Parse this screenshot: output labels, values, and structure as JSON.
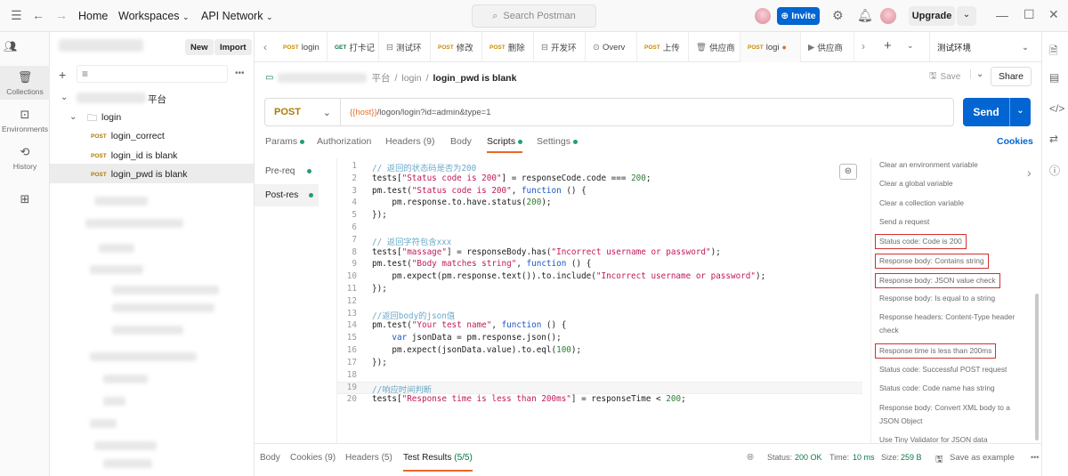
{
  "topbar": {
    "home": "Home",
    "workspaces": "Workspaces",
    "api_network": "API Network",
    "search_placeholder": "Search Postman",
    "invite": "Invite",
    "upgrade": "Upgrade"
  },
  "rail": {
    "collections": "Collections",
    "environments": "Environments",
    "history": "History"
  },
  "sidebar": {
    "new_label": "New",
    "import_label": "Import",
    "workspace_suffix": "平台",
    "folder": "login",
    "requests": [
      {
        "method": "POST",
        "name": "login_correct"
      },
      {
        "method": "POST",
        "name": "login_id is blank"
      },
      {
        "method": "POST",
        "name": "login_pwd is blank"
      }
    ]
  },
  "tabs": [
    {
      "method": "POST",
      "label": "login"
    },
    {
      "method": "GET",
      "label": "打卡记"
    },
    {
      "icon": "测",
      "label": "测试环"
    },
    {
      "method": "POST",
      "label": "修改"
    },
    {
      "method": "POST",
      "label": "删除"
    },
    {
      "icon": "开",
      "label": "开发环"
    },
    {
      "icon": "o",
      "label": "Overv"
    },
    {
      "method": "POST",
      "label": "上传"
    },
    {
      "icon": "供",
      "label": "供应商"
    },
    {
      "method": "POST",
      "label": "logi"
    },
    {
      "icon": "▶",
      "label": "供应商"
    }
  ],
  "environment": "测试环境",
  "breadcrumb": {
    "root": "平台",
    "folder": "login",
    "current": "login_pwd is blank"
  },
  "save": "Save",
  "share": "Share",
  "request": {
    "method": "POST",
    "url_var": "{{host}}",
    "url_path": "/logon/login?id=admin&type=1",
    "send": "Send"
  },
  "subtabs": {
    "params": "Params",
    "authorization": "Authorization",
    "headers": "Headers (9)",
    "body": "Body",
    "scripts": "Scripts",
    "settings": "Settings",
    "cookies": "Cookies"
  },
  "script_tabs": {
    "pre": "Pre-req",
    "post": "Post-res"
  },
  "code": [
    [
      [
        "c-cm",
        "// 返回的状态码是否为200"
      ]
    ],
    [
      [
        "c-pl",
        "tests["
      ],
      [
        "c-str",
        "\"Status code is 200\""
      ],
      [
        "c-pl",
        "] = responseCode.code === "
      ],
      [
        "c-num",
        "200"
      ],
      [
        "c-pl",
        ";"
      ]
    ],
    [
      [
        "c-pl",
        "pm.test("
      ],
      [
        "c-str",
        "\"Status code is 200\""
      ],
      [
        "c-pl",
        ", "
      ],
      [
        "c-kw",
        "function"
      ],
      [
        "c-pl",
        " () {"
      ]
    ],
    [
      [
        "c-pl",
        "    pm.response.to.have.status("
      ],
      [
        "c-num",
        "200"
      ],
      [
        "c-pl",
        ");"
      ]
    ],
    [
      [
        "c-pl",
        "});"
      ]
    ],
    [],
    [
      [
        "c-cm",
        "// 返回字符包含xxx"
      ]
    ],
    [
      [
        "c-pl",
        "tests["
      ],
      [
        "c-str",
        "\"massage\""
      ],
      [
        "c-pl",
        "] = responseBody.has("
      ],
      [
        "c-str",
        "\"Incorrect username or password\""
      ],
      [
        "c-pl",
        ");"
      ]
    ],
    [
      [
        "c-pl",
        "pm.test("
      ],
      [
        "c-str",
        "\"Body matches string\""
      ],
      [
        "c-pl",
        ", "
      ],
      [
        "c-kw",
        "function"
      ],
      [
        "c-pl",
        " () {"
      ]
    ],
    [
      [
        "c-pl",
        "    pm.expect(pm.response.text()).to.include("
      ],
      [
        "c-str",
        "\"Incorrect username or password\""
      ],
      [
        "c-pl",
        ");"
      ]
    ],
    [
      [
        "c-pl",
        "});"
      ]
    ],
    [],
    [
      [
        "c-cm",
        "//返回body的json值"
      ]
    ],
    [
      [
        "c-pl",
        "pm.test("
      ],
      [
        "c-str",
        "\"Your test name\""
      ],
      [
        "c-pl",
        ", "
      ],
      [
        "c-kw",
        "function"
      ],
      [
        "c-pl",
        " () {"
      ]
    ],
    [
      [
        "c-pl",
        "    "
      ],
      [
        "c-kw",
        "var"
      ],
      [
        "c-pl",
        " jsonData = pm.response.json();"
      ]
    ],
    [
      [
        "c-pl",
        "    pm.expect(jsonData.value).to.eql("
      ],
      [
        "c-num",
        "100"
      ],
      [
        "c-pl",
        ");"
      ]
    ],
    [
      [
        "c-pl",
        "});"
      ]
    ],
    [],
    [
      [
        "c-cm",
        "//响应时间判断"
      ]
    ],
    [
      [
        "c-pl",
        "tests["
      ],
      [
        "c-str",
        "\"Response time is less than 200ms\""
      ],
      [
        "c-pl",
        "] = responseTime < "
      ],
      [
        "c-num",
        "200"
      ],
      [
        "c-pl",
        ";"
      ]
    ]
  ],
  "snippets": [
    {
      "t": "Clear an environment variable",
      "hl": false
    },
    {
      "t": "Clear a global variable",
      "hl": false
    },
    {
      "t": "Clear a collection variable",
      "hl": false
    },
    {
      "t": "Send a request",
      "hl": false
    },
    {
      "t": "Status code: Code is 200",
      "hl": true
    },
    {
      "t": "Response body: Contains string",
      "hl": true
    },
    {
      "t": "Response body: JSON value check",
      "hl": true
    },
    {
      "t": "Response body: Is equal to a string",
      "hl": false
    },
    {
      "t": "Response headers: Content-Type header check",
      "hl": false
    },
    {
      "t": "Response time is less than 200ms",
      "hl": true
    },
    {
      "t": "Status code: Successful POST request",
      "hl": false
    },
    {
      "t": "Status code: Code name has string",
      "hl": false
    },
    {
      "t": "Response body: Convert XML body to a JSON Object",
      "hl": false
    },
    {
      "t": "Use Tiny Validator for JSON data",
      "hl": false
    }
  ],
  "response": {
    "body": "Body",
    "cookies": "Cookies (9)",
    "headers": "Headers (5)",
    "test_results": "Test Results",
    "test_count": "(5/5)",
    "status_label": "Status:",
    "status": "200 OK",
    "time_label": "Time:",
    "time": "10 ms",
    "size_label": "Size:",
    "size": "259 B",
    "save_example": "Save as example"
  }
}
